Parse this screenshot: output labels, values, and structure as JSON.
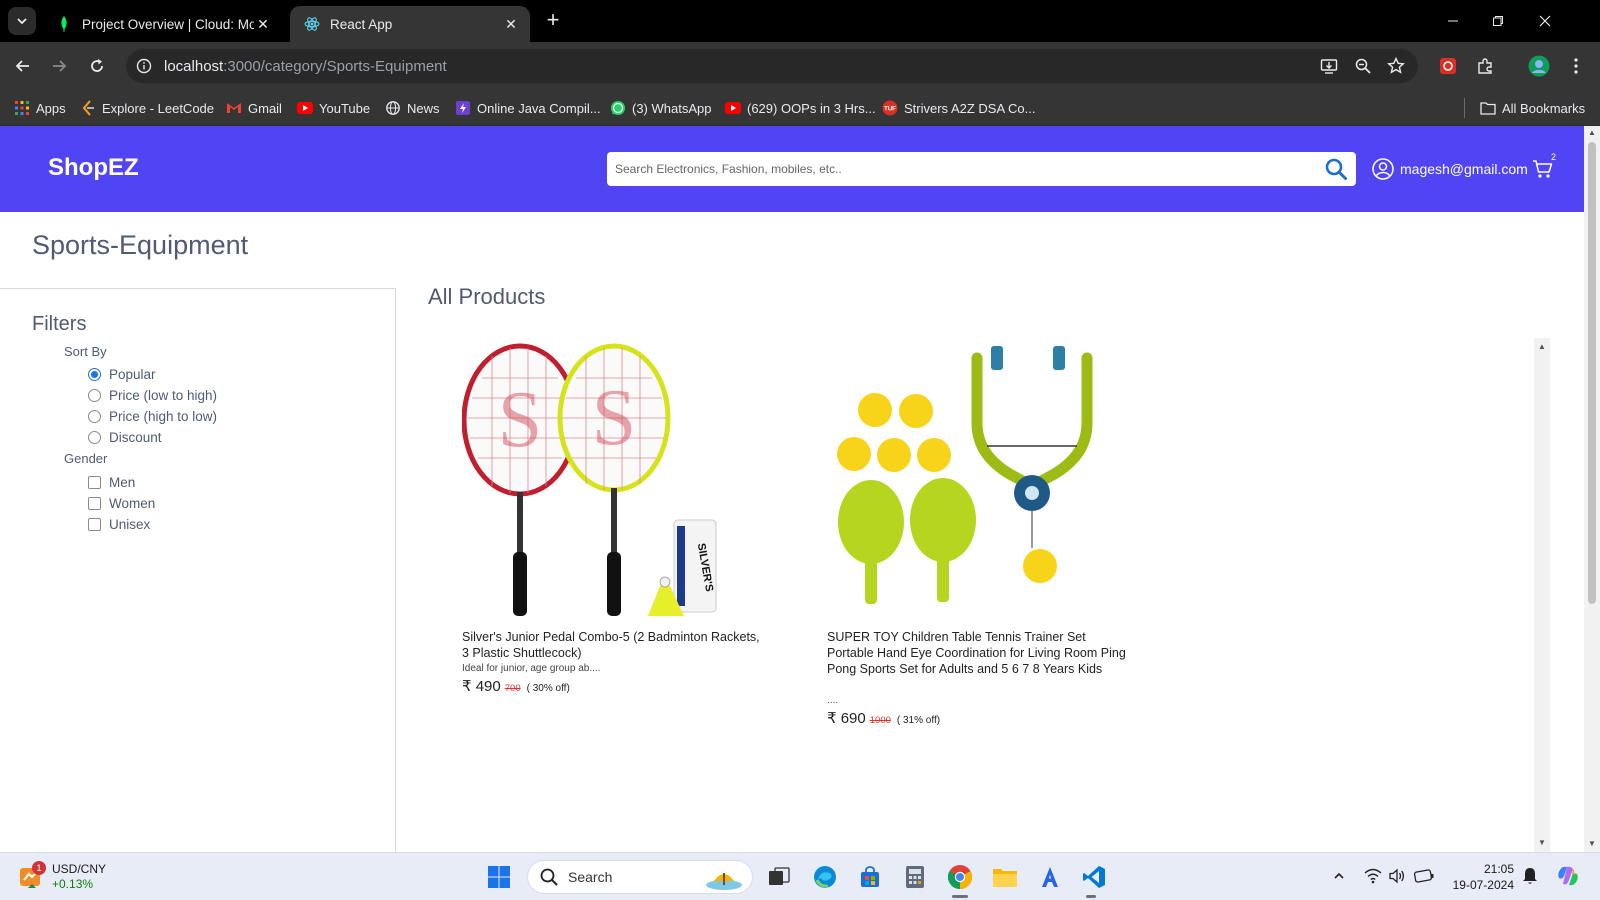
{
  "browser": {
    "tabs": [
      {
        "title": "Project Overview | Cloud: MongoDB Cloud",
        "active": false
      },
      {
        "title": "React App",
        "active": true
      }
    ],
    "url_host": "localhost",
    "url_path": ":3000/category/Sports-Equipment",
    "bookmarks": [
      {
        "label": "Apps",
        "icon": "apps-grid-icon"
      },
      {
        "label": "Explore - LeetCode",
        "icon": "leetcode-icon"
      },
      {
        "label": "Gmail",
        "icon": "gmail-icon"
      },
      {
        "label": "YouTube",
        "icon": "youtube-icon"
      },
      {
        "label": "News",
        "icon": "globe-icon"
      },
      {
        "label": "Online Java Compil...",
        "icon": "compiler-icon"
      },
      {
        "label": "(3) WhatsApp",
        "icon": "whatsapp-icon"
      },
      {
        "label": "(629) OOPs in 3 Hrs...",
        "icon": "youtube-icon"
      },
      {
        "label": "Strivers A2Z DSA Co...",
        "icon": "tuf-icon"
      }
    ],
    "all_bookmarks_label": "All Bookmarks"
  },
  "navbar": {
    "brand": "ShopEZ",
    "search_placeholder": "Search Electronics, Fashion, mobiles, etc..",
    "user_email": "magesh@gmail.com",
    "cart_count": "2",
    "color": "#5144f3"
  },
  "category_title": "Sports-Equipment",
  "filters": {
    "title": "Filters",
    "sort_label": "Sort By",
    "sort_options": [
      "Popular",
      "Price (low to high)",
      "Price (high to low)",
      "Discount"
    ],
    "sort_selected": "Popular",
    "gender_label": "Gender",
    "gender_options": [
      "Men",
      "Women",
      "Unisex"
    ]
  },
  "products_title": "All Products",
  "products": [
    {
      "name": "Silver's Junior Pedal Combo-5 (2 Badminton Rackets, 3 Plastic Shuttlecock)",
      "description": "Ideal for junior, age group ab....",
      "price": "₹ 490",
      "mrp": "700",
      "discount": "( 30% off)"
    },
    {
      "name": "SUPER TOY Children Table Tennis Trainer Set Portable Hand Eye Coordination for Living Room Ping Pong Sports Set for Adults and 5 6 7 8 Years Kids",
      "description": "....",
      "price": "₹ 690",
      "mrp": "1000",
      "discount": "( 31% off)"
    }
  ],
  "taskbar": {
    "widget_title": "USD/CNY",
    "widget_value": "+0.13%",
    "widget_badge": "1",
    "search_label": "Search",
    "time": "21:05",
    "date": "19-07-2024"
  }
}
